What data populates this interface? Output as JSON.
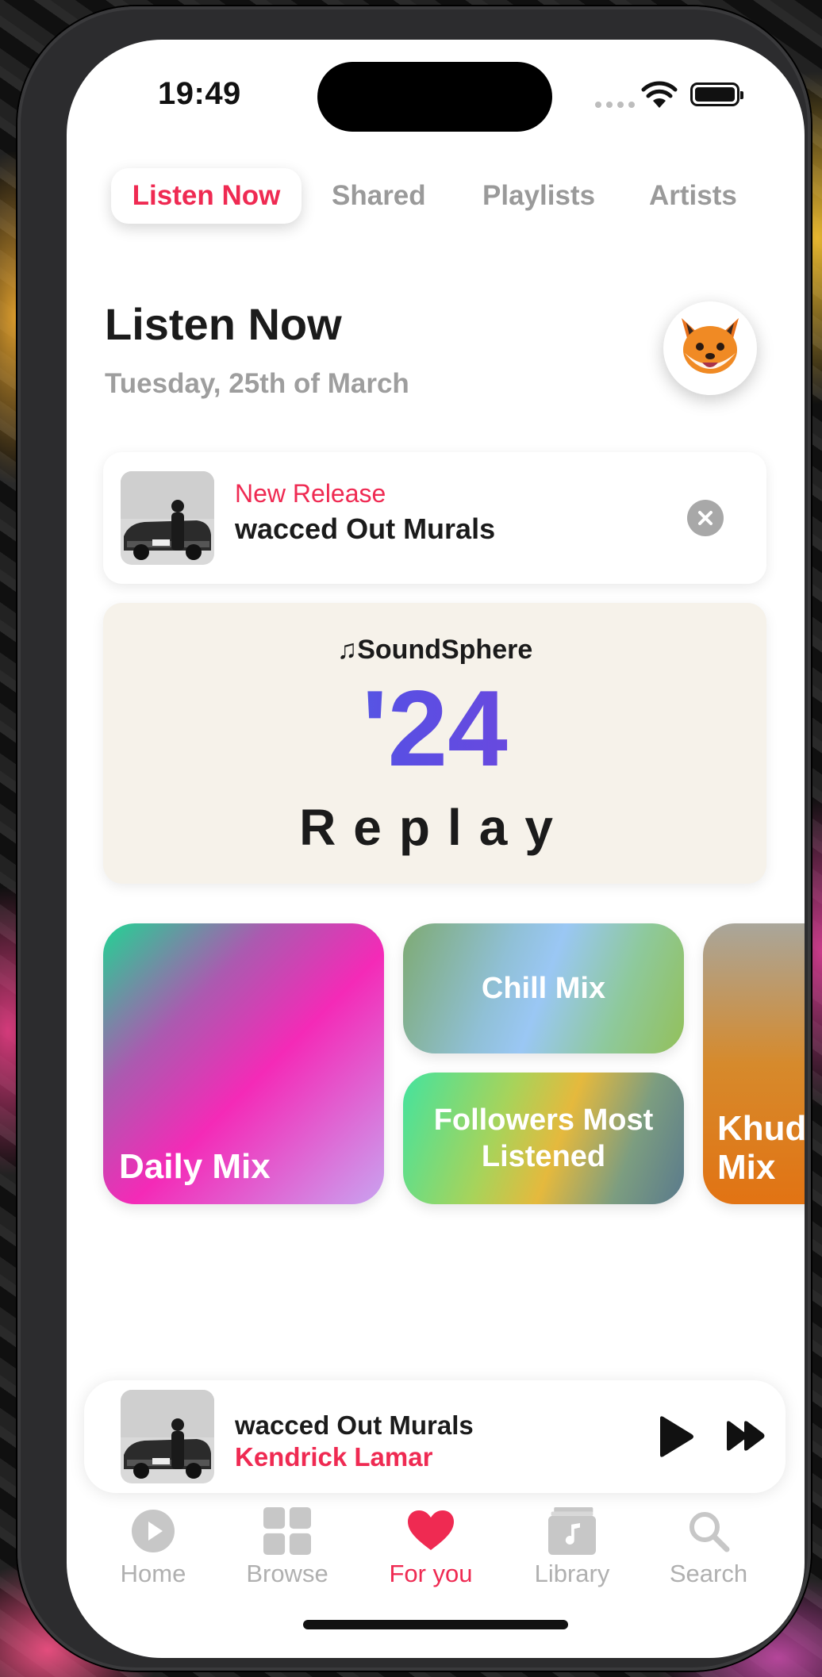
{
  "status_bar": {
    "time": "19:49"
  },
  "top_tabs": [
    {
      "label": "Listen Now",
      "active": true
    },
    {
      "label": "Shared",
      "active": false
    },
    {
      "label": "Playlists",
      "active": false
    },
    {
      "label": "Artists",
      "active": false
    }
  ],
  "header": {
    "title": "Listen Now",
    "date": "Tuesday, 25th of March",
    "avatar_icon": "fox-emoji-avatar"
  },
  "new_release": {
    "label": "New Release",
    "title": "wacced Out Murals",
    "close_icon": "close-circle-icon"
  },
  "replay_card": {
    "brand": "♫SoundSphere",
    "year": "'24",
    "word": "Replay"
  },
  "mixes": [
    {
      "label": "Daily Mix"
    },
    {
      "label": "Chill Mix"
    },
    {
      "label": "Followers Most Listened"
    },
    {
      "label": "Khud Mix"
    }
  ],
  "mini_player": {
    "title": "wacced Out Murals",
    "artist": "Kendrick Lamar"
  },
  "tab_bar": [
    {
      "label": "Home",
      "icon": "play-circle-icon",
      "active": false
    },
    {
      "label": "Browse",
      "icon": "grid-icon",
      "active": false
    },
    {
      "label": "For you",
      "icon": "heart-icon",
      "active": true
    },
    {
      "label": "Library",
      "icon": "library-icon",
      "active": false
    },
    {
      "label": "Search",
      "icon": "search-icon",
      "active": false
    }
  ],
  "colors": {
    "accent": "#ef2a52",
    "inactive": "#9a9a9a",
    "card_bg": "#f6f2ea"
  }
}
